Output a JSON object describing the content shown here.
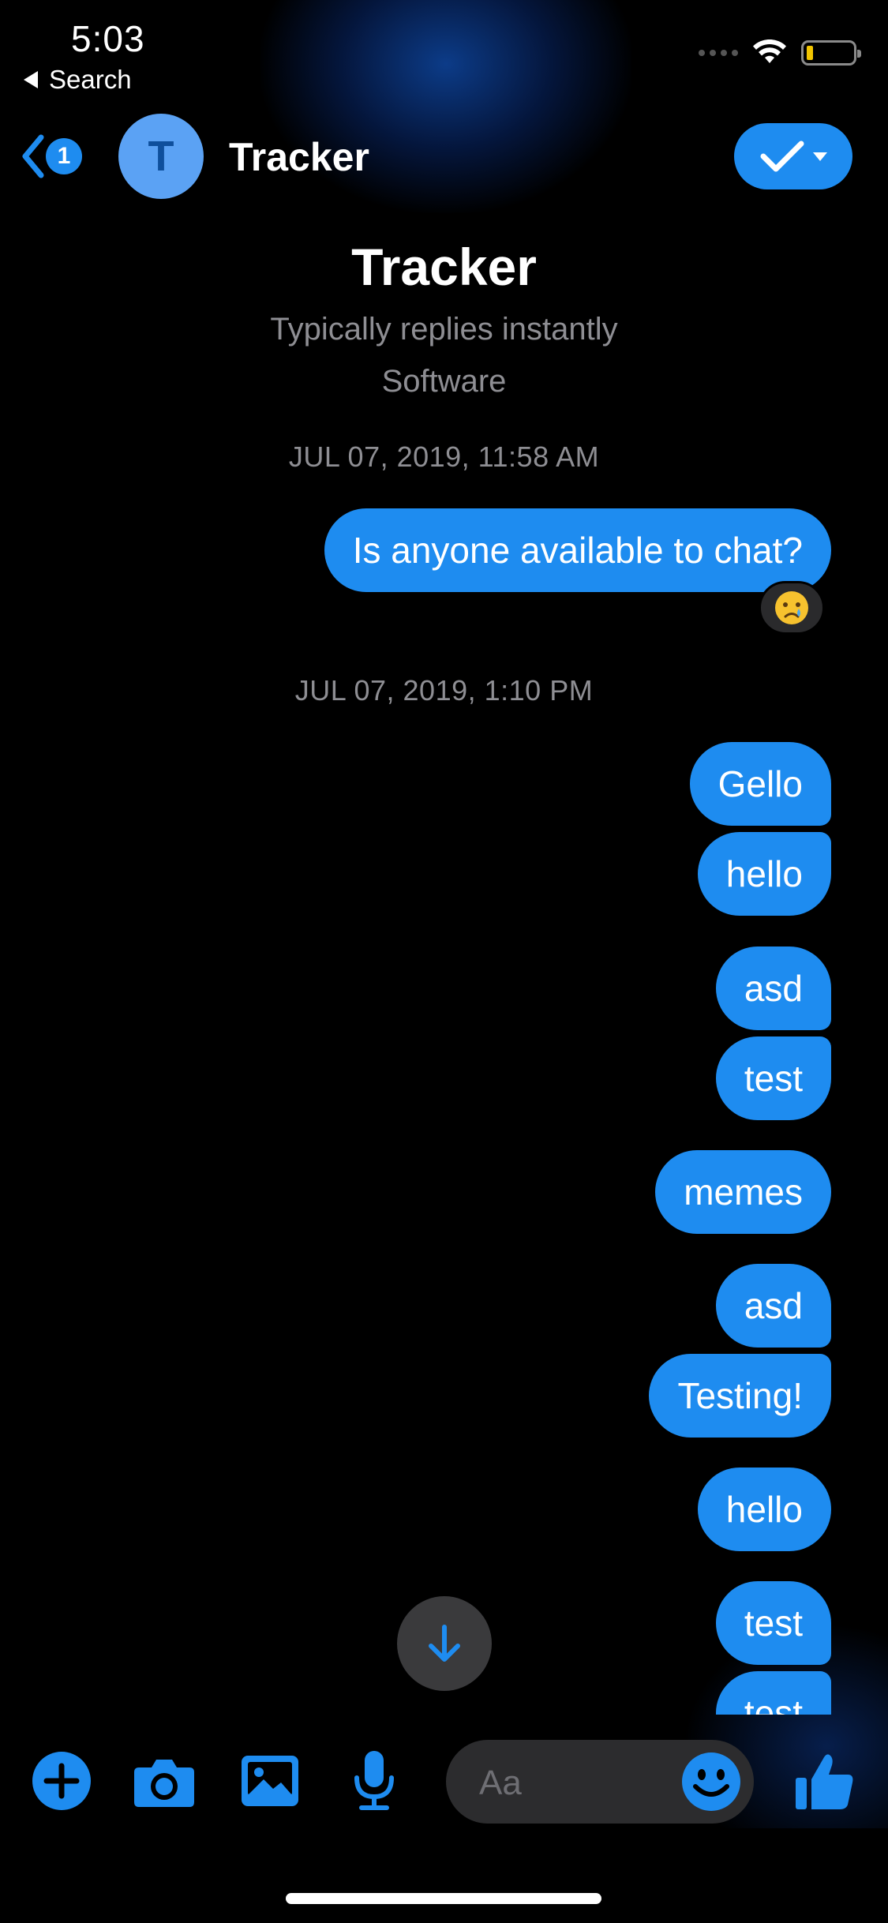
{
  "status_bar": {
    "time": "5:03",
    "back_label": "Search"
  },
  "header": {
    "unread_count": "1",
    "avatar_initial": "T",
    "title": "Tracker"
  },
  "profile": {
    "name": "Tracker",
    "subtitle": "Typically replies instantly",
    "category": "Software"
  },
  "messages": {
    "timestamp_1": "JUL 07, 2019, 11:58 AM",
    "m1": "Is anyone available to chat?",
    "reaction_1": "crying-face",
    "timestamp_2": "JUL 07, 2019, 1:10 PM",
    "m2": "Gello",
    "m3": "hello",
    "m4": "asd",
    "m5": "test",
    "m6": "memes",
    "m7": "asd",
    "m8": "Testing!",
    "m9": "hello",
    "m10": "test",
    "m11": "test"
  },
  "composer": {
    "placeholder": "Aa",
    "icons": [
      "plus-icon",
      "camera-icon",
      "photo-icon",
      "microphone-icon",
      "emoji-icon",
      "thumbs-up-icon"
    ]
  },
  "colors": {
    "accent": "#1e8cf0",
    "background": "#000000",
    "secondary_text": "#8e8e93"
  }
}
